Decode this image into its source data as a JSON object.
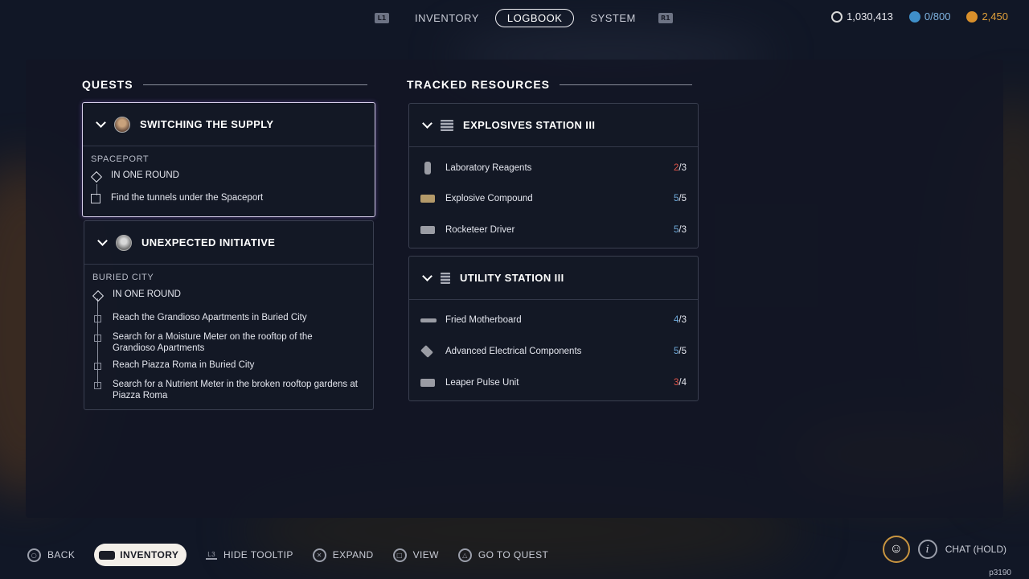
{
  "nav": {
    "left_button": "L1",
    "right_button": "R1",
    "tabs": [
      {
        "label": "INVENTORY",
        "active": false
      },
      {
        "label": "LOGBOOK",
        "active": true
      },
      {
        "label": "SYSTEM",
        "active": false
      }
    ]
  },
  "currency": {
    "coins": "1,030,413",
    "storage": "0/800",
    "tokens": "2,450"
  },
  "quests": {
    "header": "QUESTS",
    "items": [
      {
        "title": "SWITCHING THE SUPPLY",
        "location": "SPACEPORT",
        "condition": "IN ONE ROUND",
        "objectives": [
          "Find the tunnels under the Spaceport"
        ]
      },
      {
        "title": "UNEXPECTED INITIATIVE",
        "location": "BURIED CITY",
        "condition": "IN ONE ROUND",
        "objectives": [
          "Reach the Grandioso Apartments in Buried City",
          "Search for a Moisture Meter on the rooftop of the Grandioso Apartments",
          "Reach Piazza Roma in Buried City",
          "Search for a Nutrient Meter in the broken rooftop gardens at Piazza Roma"
        ]
      }
    ]
  },
  "resources": {
    "header": "TRACKED RESOURCES",
    "stations": [
      {
        "title": "EXPLOSIVES STATION III",
        "items": [
          {
            "name": "Laboratory Reagents",
            "have": "2",
            "need": "3",
            "status": "low"
          },
          {
            "name": "Explosive Compound",
            "have": "5",
            "need": "5",
            "status": "ok"
          },
          {
            "name": "Rocketeer Driver",
            "have": "5",
            "need": "3",
            "status": "ok"
          }
        ]
      },
      {
        "title": "UTILITY STATION III",
        "items": [
          {
            "name": "Fried Motherboard",
            "have": "4",
            "need": "3",
            "status": "ok"
          },
          {
            "name": "Advanced Electrical Components",
            "have": "5",
            "need": "5",
            "status": "ok"
          },
          {
            "name": "Leaper Pulse Unit",
            "have": "3",
            "need": "4",
            "status": "low"
          }
        ]
      }
    ]
  },
  "bottom_bar": {
    "back": "BACK",
    "inventory": "INVENTORY",
    "hide_tooltip_button": "L3",
    "hide_tooltip": "HIDE TOOLTIP",
    "expand": "EXPAND",
    "view": "VIEW",
    "go_to_quest": "GO TO QUEST",
    "chat": "CHAT (HOLD)"
  },
  "player_id": "p3190",
  "colors": {
    "low": "#e0544a",
    "ok": "#6ea8d8",
    "tab_active_border": "#f0f0f4"
  }
}
